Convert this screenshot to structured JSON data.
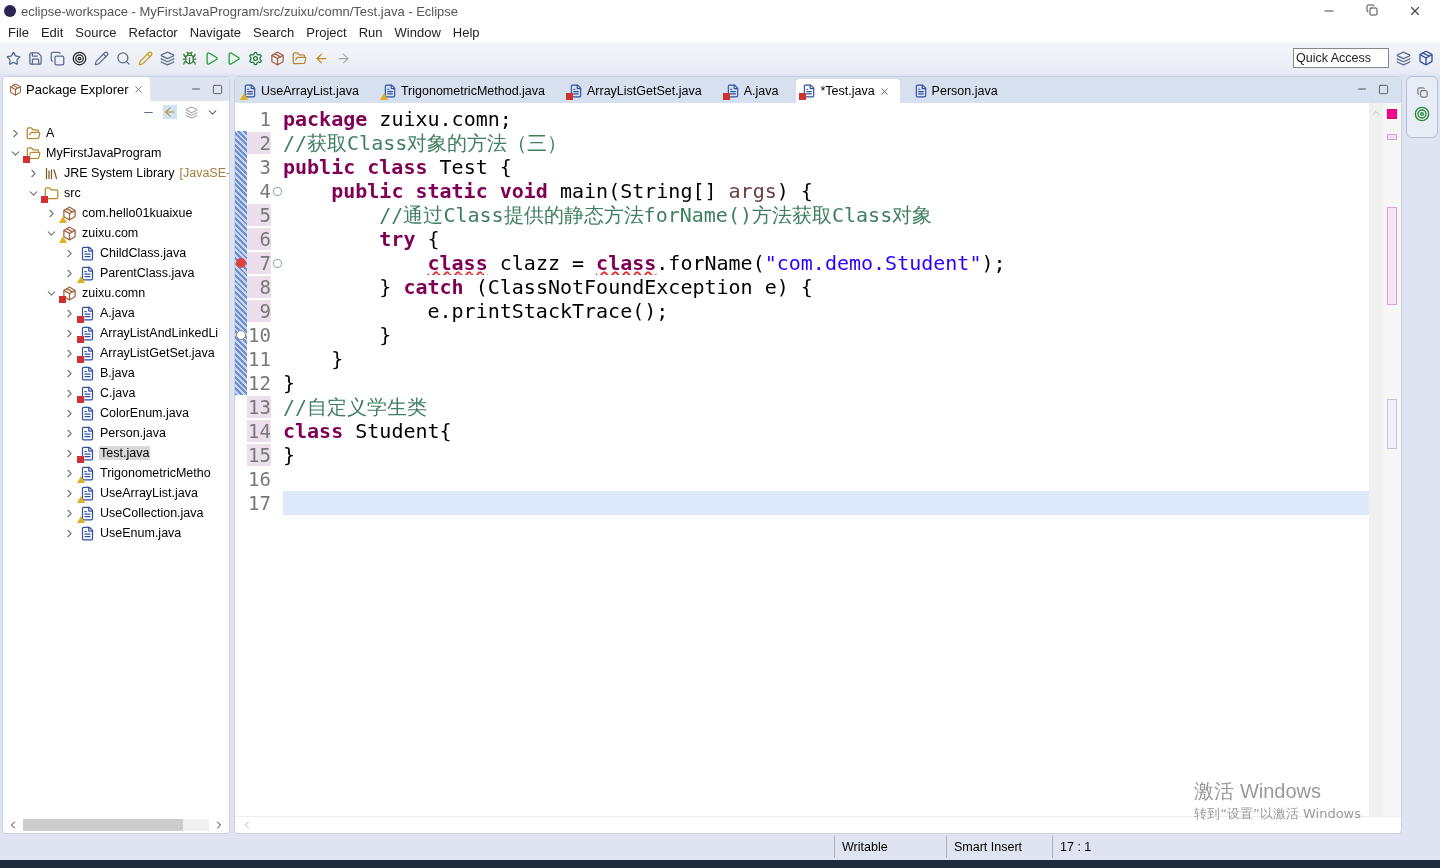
{
  "window": {
    "title": "eclipse-workspace - MyFirstJavaProgram/src/zuixu/comn/Test.java - Eclipse"
  },
  "menu": [
    "File",
    "Edit",
    "Source",
    "Refactor",
    "Navigate",
    "Search",
    "Project",
    "Run",
    "Window",
    "Help"
  ],
  "quick_access": {
    "placeholder": "Quick Access"
  },
  "explorer": {
    "title": "Package Explorer",
    "tree": [
      {
        "label": "A",
        "kind": "project",
        "error": false,
        "warning": false,
        "expanded": false,
        "selected": false
      },
      {
        "label": "MyFirstJavaProgram",
        "kind": "project",
        "error": true,
        "warning": false,
        "expanded": true,
        "selected": false,
        "children": [
          {
            "label": "JRE System Library",
            "suffix": "[JavaSE-",
            "kind": "library",
            "error": false,
            "warning": false,
            "expanded": false,
            "selected": false
          },
          {
            "label": "src",
            "kind": "folder",
            "error": true,
            "warning": false,
            "expanded": true,
            "selected": false,
            "children": [
              {
                "label": "com.hello01kuaixue",
                "kind": "package",
                "error": false,
                "warning": true,
                "expanded": false,
                "selected": false
              },
              {
                "label": "zuixu.com",
                "kind": "package",
                "error": false,
                "warning": true,
                "expanded": true,
                "selected": false,
                "children": [
                  {
                    "label": "ChildClass.java",
                    "kind": "file",
                    "error": false,
                    "warning": false,
                    "expanded": false,
                    "selected": false
                  },
                  {
                    "label": "ParentClass.java",
                    "kind": "file",
                    "error": false,
                    "warning": true,
                    "expanded": false,
                    "selected": false
                  }
                ]
              },
              {
                "label": "zuixu.comn",
                "kind": "package",
                "error": true,
                "warning": false,
                "expanded": true,
                "selected": false,
                "children": [
                  {
                    "label": "A.java",
                    "kind": "file",
                    "error": true,
                    "warning": false,
                    "expanded": false,
                    "selected": false
                  },
                  {
                    "label": "ArrayListAndLinkedLi",
                    "kind": "file",
                    "error": true,
                    "warning": false,
                    "expanded": false,
                    "selected": false
                  },
                  {
                    "label": "ArrayListGetSet.java",
                    "kind": "file",
                    "error": true,
                    "warning": false,
                    "expanded": false,
                    "selected": false
                  },
                  {
                    "label": "B.java",
                    "kind": "file",
                    "error": false,
                    "warning": false,
                    "expanded": false,
                    "selected": false
                  },
                  {
                    "label": "C.java",
                    "kind": "file",
                    "error": true,
                    "warning": false,
                    "expanded": false,
                    "selected": false
                  },
                  {
                    "label": "ColorEnum.java",
                    "kind": "file",
                    "error": false,
                    "warning": false,
                    "expanded": false,
                    "selected": false
                  },
                  {
                    "label": "Person.java",
                    "kind": "file",
                    "error": false,
                    "warning": false,
                    "expanded": false,
                    "selected": false
                  },
                  {
                    "label": "Test.java",
                    "kind": "file",
                    "error": true,
                    "warning": false,
                    "expanded": false,
                    "selected": true
                  },
                  {
                    "label": "TrigonometricMetho",
                    "kind": "file",
                    "error": false,
                    "warning": true,
                    "expanded": false,
                    "selected": false
                  },
                  {
                    "label": "UseArrayList.java",
                    "kind": "file",
                    "error": false,
                    "warning": true,
                    "expanded": false,
                    "selected": false
                  },
                  {
                    "label": "UseCollection.java",
                    "kind": "file",
                    "error": false,
                    "warning": true,
                    "expanded": false,
                    "selected": false
                  },
                  {
                    "label": "UseEnum.java",
                    "kind": "file",
                    "error": false,
                    "warning": false,
                    "expanded": false,
                    "selected": false
                  }
                ]
              }
            ]
          }
        ]
      }
    ]
  },
  "tabs": [
    {
      "label": "UseArrayList.java",
      "error": false,
      "warning": true,
      "selected": false
    },
    {
      "label": "TrigonometricMethod.java",
      "error": false,
      "warning": true,
      "selected": false
    },
    {
      "label": "ArrayListGetSet.java",
      "error": true,
      "warning": false,
      "selected": false
    },
    {
      "label": "A.java",
      "error": true,
      "warning": false,
      "selected": false
    },
    {
      "label": "*Test.java",
      "error": true,
      "warning": false,
      "selected": true
    },
    {
      "label": "Person.java",
      "error": false,
      "warning": false,
      "selected": false
    }
  ],
  "code": [
    {
      "number": "1",
      "changed": false,
      "error_marker": false,
      "removed_marker": false,
      "fold": false,
      "current": false,
      "tokens": [
        {
          "kind": "keyword",
          "text": "package"
        },
        {
          "kind": "plain",
          "text": " zuixu.comn;"
        }
      ]
    },
    {
      "number": "2",
      "changed": true,
      "error_marker": false,
      "removed_marker": false,
      "fold": false,
      "current": false,
      "tokens": [
        {
          "kind": "comment",
          "text": "//获取Class对象的方法（三）"
        }
      ]
    },
    {
      "number": "3",
      "changed": false,
      "error_marker": false,
      "removed_marker": false,
      "fold": false,
      "current": false,
      "tokens": [
        {
          "kind": "keyword",
          "text": "public class"
        },
        {
          "kind": "plain",
          "text": " Test {"
        }
      ]
    },
    {
      "number": "4",
      "changed": false,
      "error_marker": false,
      "removed_marker": false,
      "fold": true,
      "current": false,
      "tokens": [
        {
          "kind": "keyword",
          "text": "    public static void"
        },
        {
          "kind": "plain",
          "text": " main(String[] "
        },
        {
          "kind": "param",
          "text": "args"
        },
        {
          "kind": "plain",
          "text": ") {"
        }
      ]
    },
    {
      "number": "5",
      "changed": true,
      "error_marker": false,
      "removed_marker": false,
      "fold": false,
      "current": false,
      "tokens": [
        {
          "kind": "comment",
          "text": "        //通过Class提供的静态方法forName()方法获取Class对象"
        }
      ]
    },
    {
      "number": "6",
      "changed": true,
      "error_marker": false,
      "removed_marker": false,
      "fold": false,
      "current": false,
      "tokens": [
        {
          "kind": "keyword",
          "text": "        try"
        },
        {
          "kind": "plain",
          "text": " {"
        }
      ]
    },
    {
      "number": "7",
      "changed": true,
      "error_marker": true,
      "removed_marker": false,
      "fold": true,
      "current": false,
      "tokens": [
        {
          "kind": "error",
          "text": "            class"
        },
        {
          "kind": "plain",
          "text": " clazz = "
        },
        {
          "kind": "error",
          "text": "class"
        },
        {
          "kind": "plain",
          "text": ".forName("
        },
        {
          "kind": "string",
          "text": "\"com.demo.Student\""
        },
        {
          "kind": "plain",
          "text": ");"
        }
      ]
    },
    {
      "number": "8",
      "changed": true,
      "error_marker": false,
      "removed_marker": false,
      "fold": false,
      "current": false,
      "tokens": [
        {
          "kind": "plain",
          "text": "        } "
        },
        {
          "kind": "keyword",
          "text": "catch"
        },
        {
          "kind": "plain",
          "text": " (ClassNotFoundException e) {"
        }
      ]
    },
    {
      "number": "9",
      "changed": true,
      "error_marker": false,
      "removed_marker": false,
      "fold": false,
      "current": false,
      "tokens": [
        {
          "kind": "plain",
          "text": "            e.printStackTrace();"
        }
      ]
    },
    {
      "number": "10",
      "changed": false,
      "error_marker": false,
      "removed_marker": true,
      "fold": false,
      "current": false,
      "tokens": [
        {
          "kind": "plain",
          "text": "        }"
        }
      ]
    },
    {
      "number": "11",
      "changed": false,
      "error_marker": false,
      "removed_marker": false,
      "fold": false,
      "current": false,
      "tokens": [
        {
          "kind": "plain",
          "text": "    }"
        }
      ]
    },
    {
      "number": "12",
      "changed": false,
      "error_marker": false,
      "removed_marker": false,
      "fold": false,
      "current": false,
      "tokens": [
        {
          "kind": "plain",
          "text": "}"
        }
      ]
    },
    {
      "number": "13",
      "changed": true,
      "error_marker": false,
      "removed_marker": false,
      "fold": false,
      "current": false,
      "tokens": [
        {
          "kind": "comment",
          "text": "//自定义学生类"
        }
      ]
    },
    {
      "number": "14",
      "changed": true,
      "error_marker": false,
      "removed_marker": false,
      "fold": false,
      "current": false,
      "tokens": [
        {
          "kind": "keyword",
          "text": "class"
        },
        {
          "kind": "plain",
          "text": " Student{"
        }
      ]
    },
    {
      "number": "15",
      "changed": true,
      "error_marker": false,
      "removed_marker": false,
      "fold": false,
      "current": false,
      "tokens": [
        {
          "kind": "plain",
          "text": "}"
        }
      ]
    },
    {
      "number": "16",
      "changed": false,
      "error_marker": false,
      "removed_marker": false,
      "fold": false,
      "current": false
    },
    {
      "number": "17",
      "changed": false,
      "error_marker": false,
      "removed_marker": false,
      "fold": false,
      "current": true
    }
  ],
  "activation": {
    "title": "激活 Windows",
    "hint": "转到“设置”以激活 Windows"
  },
  "status_bar": [
    "Writable",
    "Smart Insert",
    "17 : 1"
  ]
}
